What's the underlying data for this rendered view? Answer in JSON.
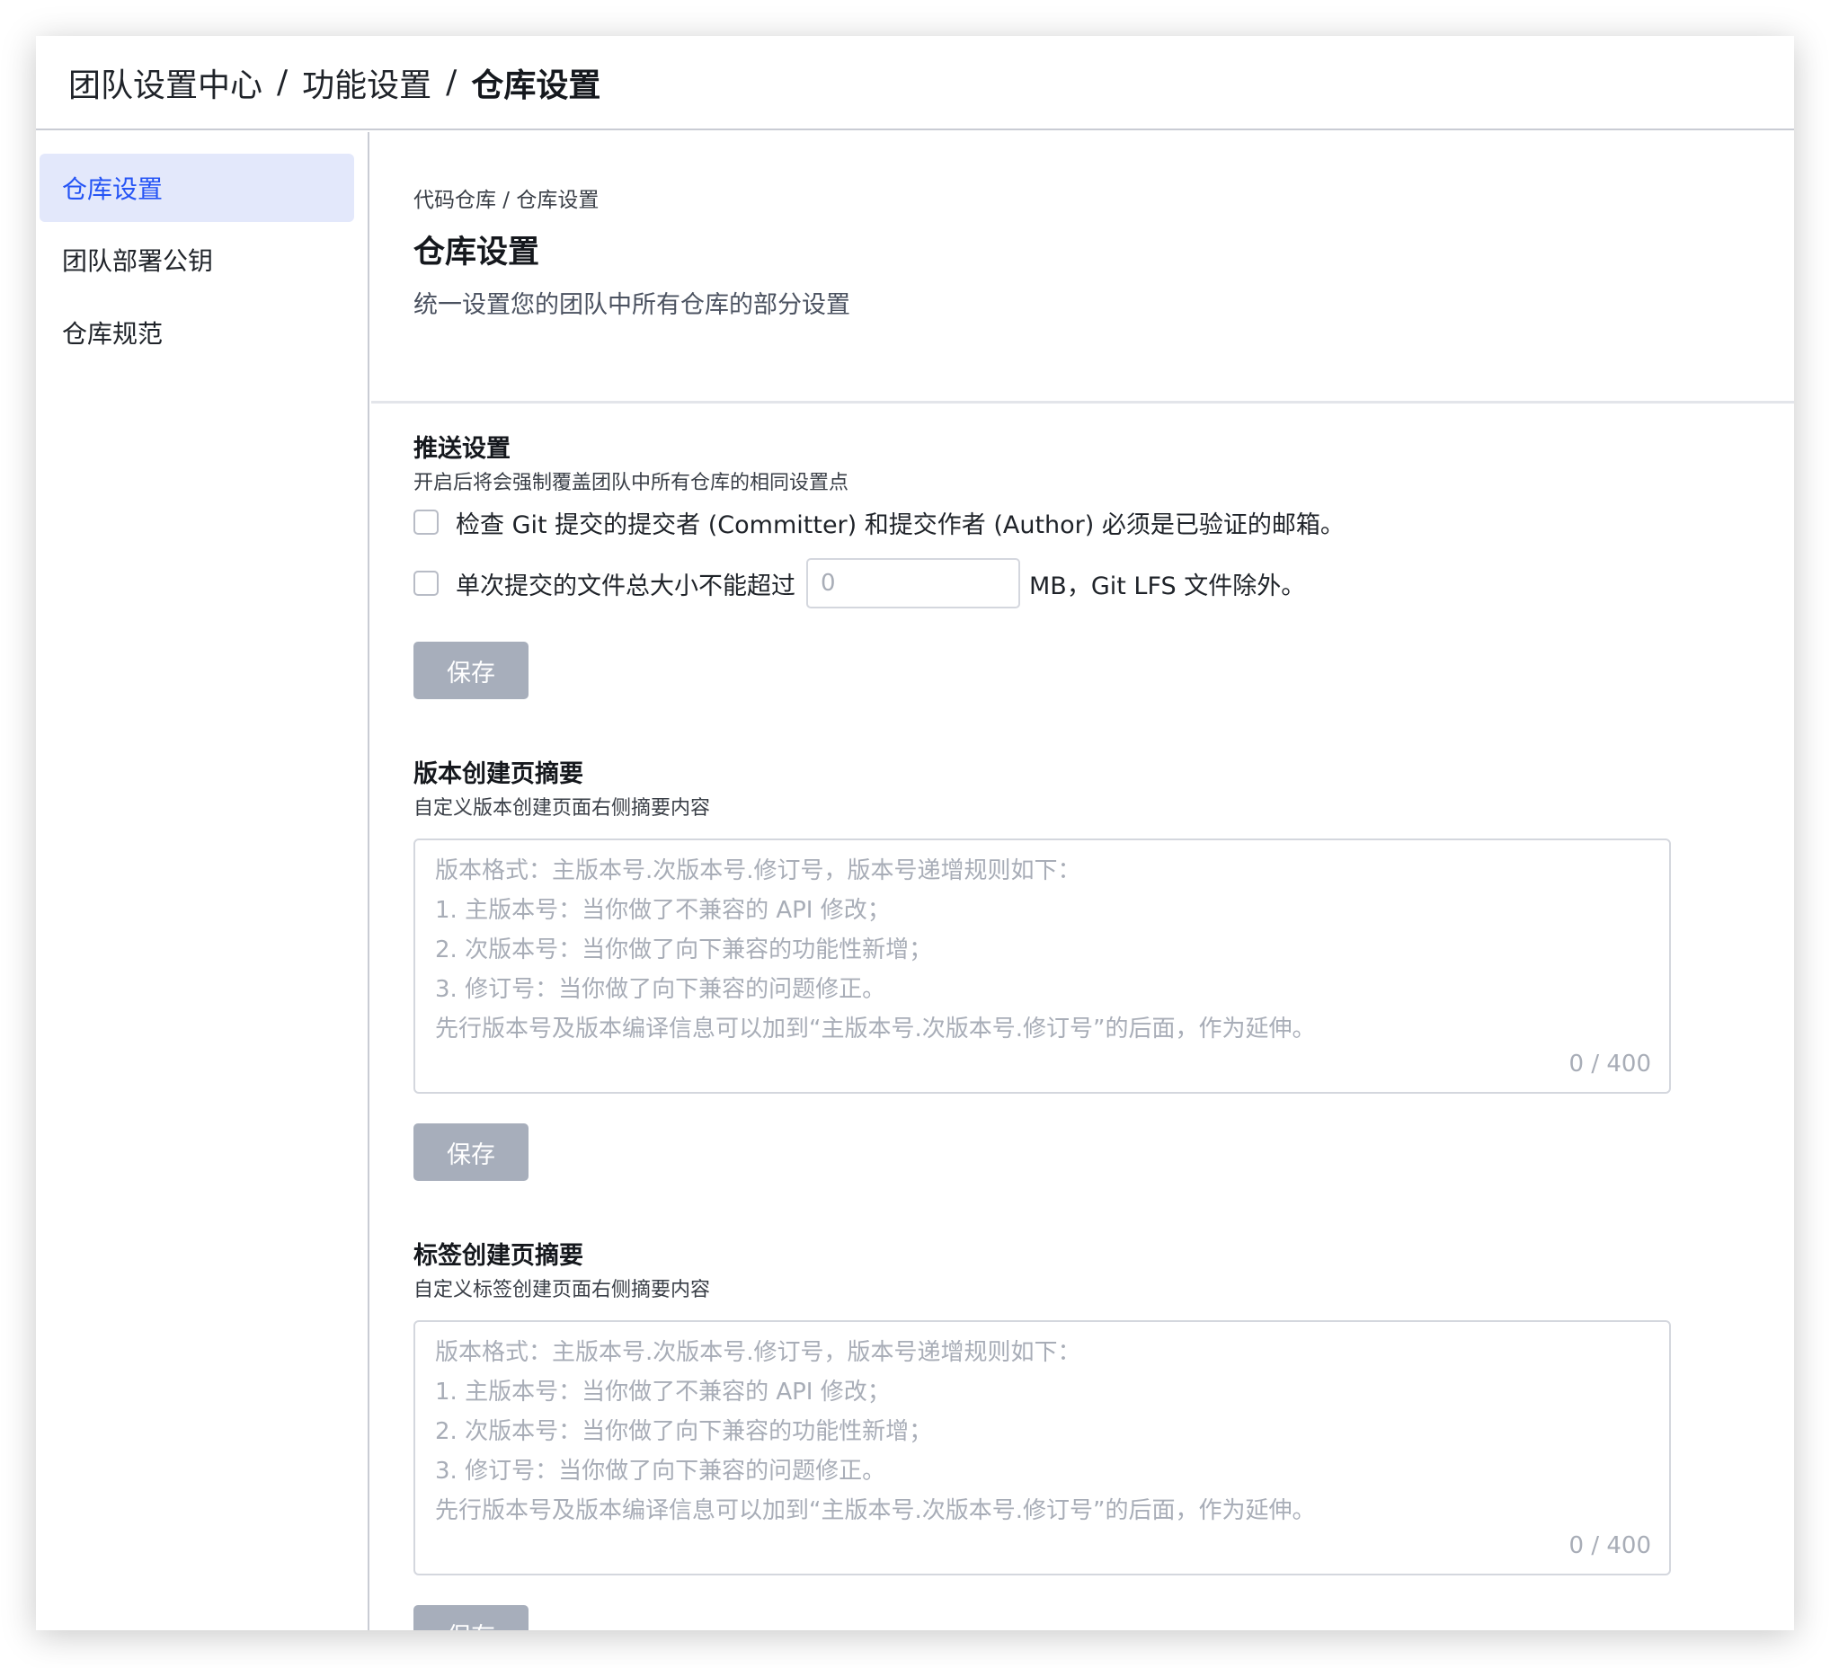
{
  "breadcrumb": {
    "items": [
      "团队设置中心",
      "功能设置",
      "仓库设置"
    ],
    "separator": "/"
  },
  "sidebar": {
    "items": [
      {
        "label": "仓库设置",
        "active": true
      },
      {
        "label": "团队部署公钥",
        "active": false
      },
      {
        "label": "仓库规范",
        "active": false
      }
    ]
  },
  "header": {
    "sub_breadcrumb": "代码仓库 / 仓库设置",
    "title": "仓库设置",
    "description": "统一设置您的团队中所有仓库的部分设置"
  },
  "push_settings": {
    "title": "推送设置",
    "description": "开启后将会强制覆盖团队中所有仓库的相同设置点",
    "check_email_label": "检查 Git 提交的提交者 (Committer) 和提交作者 (Author) 必须是已验证的邮箱。",
    "size_limit_prefix": "单次提交的文件总大小不能超过",
    "size_limit_placeholder": "0",
    "size_limit_suffix": "MB，Git LFS 文件除外。",
    "save_label": "保存"
  },
  "release_summary": {
    "title": "版本创建页摘要",
    "description": "自定义版本创建页面右侧摘要内容",
    "placeholder": "版本格式：主版本号.次版本号.修订号，版本号递增规则如下：\n1. 主版本号：当你做了不兼容的 API 修改；\n2. 次版本号：当你做了向下兼容的功能性新增；\n3. 修订号：当你做了向下兼容的问题修正。\n先行版本号及版本编译信息可以加到“主版本号.次版本号.修订号”的后面，作为延伸。",
    "counter": "0 / 400",
    "save_label": "保存"
  },
  "tag_summary": {
    "title": "标签创建页摘要",
    "description": "自定义标签创建页面右侧摘要内容",
    "placeholder": "版本格式：主版本号.次版本号.修订号，版本号递增规则如下：\n1. 主版本号：当你做了不兼容的 API 修改；\n2. 次版本号：当你做了向下兼容的功能性新增；\n3. 修订号：当你做了向下兼容的问题修正。\n先行版本号及版本编译信息可以加到“主版本号.次版本号.修订号”的后面，作为延伸。",
    "counter": "0 / 400",
    "save_label": "保存"
  },
  "colors": {
    "accent": "#2554f5",
    "active_bg": "#e3e8fb",
    "disabled_button": "#a7aebb"
  }
}
